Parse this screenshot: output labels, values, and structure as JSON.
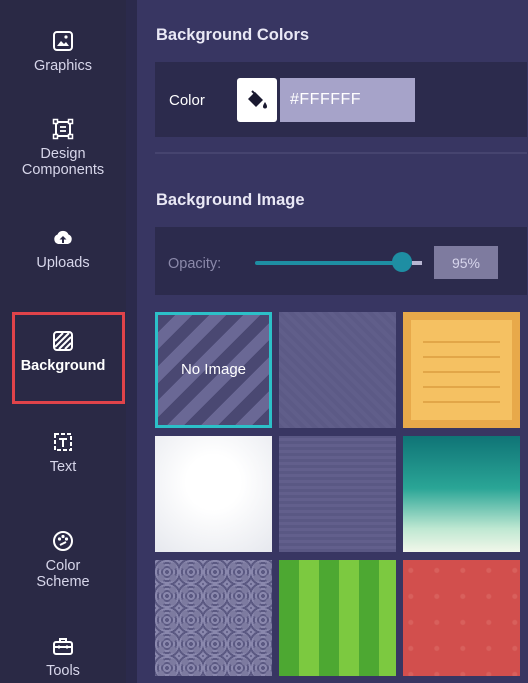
{
  "sidebar": {
    "items": [
      {
        "label": "Graphics",
        "icon": "image-icon"
      },
      {
        "label": "Design\nComponents",
        "icon": "components-icon"
      },
      {
        "label": "Uploads",
        "icon": "cloud-upload-icon"
      },
      {
        "label": "Background",
        "icon": "background-hatch-icon",
        "active": true
      },
      {
        "label": "Text",
        "icon": "text-box-icon"
      },
      {
        "label": "Color\nScheme",
        "icon": "palette-icon"
      },
      {
        "label": "Tools",
        "icon": "toolbox-icon"
      }
    ]
  },
  "background_colors": {
    "title": "Background Colors",
    "color_label": "Color",
    "hex_value": "#FFFFFF",
    "bucket_icon": "paint-bucket-icon"
  },
  "background_image": {
    "title": "Background Image",
    "opacity_label": "Opacity:",
    "opacity_value": "95%",
    "opacity_fraction": 0.95,
    "tiles": [
      {
        "name": "no-image",
        "label": "No Image",
        "selected": true
      },
      {
        "name": "diagonal-stripes"
      },
      {
        "name": "wooden-crate"
      },
      {
        "name": "white-gradient"
      },
      {
        "name": "horizontal-lines"
      },
      {
        "name": "teal-gradient"
      },
      {
        "name": "swirl-pattern"
      },
      {
        "name": "green-stripes"
      },
      {
        "name": "red-speckle"
      }
    ]
  },
  "colors": {
    "selected_border": "#2cc0c8",
    "active_highlight": "#e0434a",
    "slider": "#1e8ea3"
  }
}
